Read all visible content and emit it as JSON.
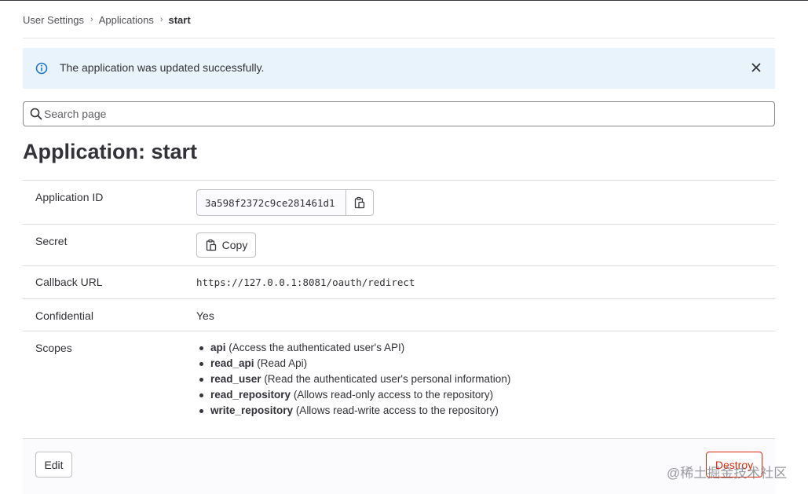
{
  "breadcrumb": {
    "items": [
      "User Settings",
      "Applications"
    ],
    "current": "start"
  },
  "alert": {
    "message": "The application was updated successfully.",
    "icon": "info-icon",
    "close_icon": "close-icon",
    "background": "#e9f3fc"
  },
  "search": {
    "placeholder": "Search page",
    "value": ""
  },
  "page_title": "Application: start",
  "details": {
    "application_id": {
      "label": "Application ID",
      "value": "3a598f2372c9ce281461d1"
    },
    "secret": {
      "label": "Secret",
      "button": "Copy"
    },
    "callback_url": {
      "label": "Callback URL",
      "value": "https://127.0.0.1:8081/oauth/redirect"
    },
    "confidential": {
      "label": "Confidential",
      "value": "Yes"
    },
    "scopes": {
      "label": "Scopes",
      "items": [
        {
          "name": "api",
          "description": "(Access the authenticated user's API)"
        },
        {
          "name": "read_api",
          "description": "(Read Api)"
        },
        {
          "name": "read_user",
          "description": "(Read the authenticated user's personal information)"
        },
        {
          "name": "read_repository",
          "description": "(Allows read-only access to the repository)"
        },
        {
          "name": "write_repository",
          "description": "(Allows read-write access to the repository)"
        }
      ]
    }
  },
  "actions": {
    "edit": "Edit",
    "destroy": "Destroy",
    "destroy_color": "#dd2b0e"
  },
  "watermark": "@稀土掘金技术社区"
}
